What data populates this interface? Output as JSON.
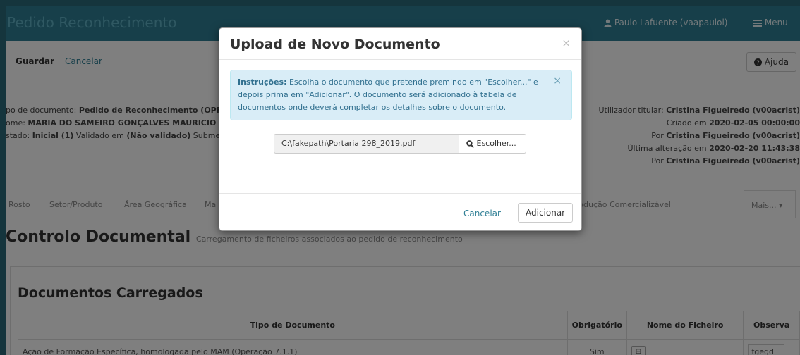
{
  "header": {
    "title": "Pedido Reconhecimento",
    "user_label": "Paulo Lafuente (vaapaulol)",
    "menu_label": "Menu"
  },
  "toolbar": {
    "save_label": "Guardar",
    "cancel_label": "Cancelar",
    "help_label": "Ajuda"
  },
  "info_left": {
    "line1_prefix": "po de documento: ",
    "line1_value": "Pedido de Reconhecimento (OPF",
    "line2_prefix": "ome: ",
    "line2_value": "MARIA DO SAMEIRO GONÇALVES MAURICIO",
    "line3_prefix": "stado: ",
    "line3_value": "Inicial (1)",
    "line3_mid": " Validado em ",
    "line3_value2": "(Não validado)",
    "line3_suffix": " Submet"
  },
  "info_right": {
    "line1_prefix": "Utilizador titular: ",
    "line1_value": "Cristina Figueiredo (v00acrist)",
    "line2_prefix": "Criado em ",
    "line2_value": "2020-02-05 00:00:00",
    "line3_prefix": "Por ",
    "line3_value": "Cristina Figueiredo (v00acrist)",
    "line4_prefix": "Última alteração em ",
    "line4_value": "2020-02-20 11:43:38",
    "line5_prefix": "Por ",
    "line5_value": "Cristina Figueiredo (v00acrist)"
  },
  "tabs": {
    "items": [
      "Rosto",
      "Setor/Produto",
      "Área Geográfica",
      "Ma",
      "rodução Comercializável"
    ],
    "more_label": "Mais..."
  },
  "page": {
    "title": "Controlo Documental",
    "subtitle": "Carregamento de ficheiros associados ao pedido de reconhecimento"
  },
  "documents": {
    "heading": "Documentos Carregados",
    "columns": [
      "Tipo de Documento",
      "Obrigatório",
      "Nome do Ficheiro",
      "Observa"
    ],
    "rows": [
      {
        "tipo": "Ação de Formação Específica, homologada pelo MAM (Operação 7.1.1)",
        "obrigatorio": "Sim",
        "observacao": "fgegd"
      }
    ]
  },
  "modal": {
    "title": "Upload de Novo Documento",
    "close": "×",
    "alert_strong": "Instruções:",
    "alert_text": " Escolha o documento que pretende premindo em \"Escolher...\" e depois prima em \"Adicionar\". O documento será adicionado à tabela de documentos onde deverá completar os detalhes sobre o documento.",
    "alert_close": "×",
    "file_path": "C:\\fakepath\\Portaria 298_2019.pdf",
    "choose_label": "Escolher...",
    "cancel_label": "Cancelar",
    "add_label": "Adicionar"
  },
  "colors": {
    "header_bg": "#2f7f95",
    "link": "#2f7f95",
    "alert_bg": "#d9edf7",
    "alert_text": "#31708f"
  }
}
